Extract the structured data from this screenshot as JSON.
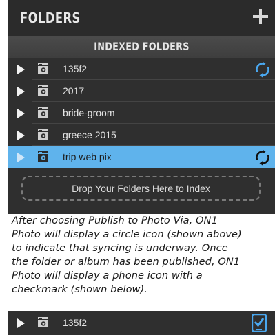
{
  "panel": {
    "title": "FOLDERS",
    "add_icon": "plus-icon",
    "section_title": "INDEXED FOLDERS",
    "folders": [
      {
        "name": "135f2",
        "syncing": true,
        "selected": false
      },
      {
        "name": "2017",
        "syncing": false,
        "selected": false
      },
      {
        "name": "bride-groom",
        "syncing": false,
        "selected": false
      },
      {
        "name": "greece 2015",
        "syncing": false,
        "selected": false
      },
      {
        "name": "trip web pix",
        "syncing": true,
        "selected": true
      }
    ],
    "drop_zone": "Drop Your Folders Here to Index"
  },
  "caption": {
    "lines": [
      "After choosing Publish to Photo Via, ON1",
      "Photo will display a circle icon (shown above)",
      "to indicate that syncing is underway. Once",
      "the folder or album has been published, ON1",
      "Photo will display a phone icon with a",
      "checkmark (shown below)."
    ]
  },
  "published_row": {
    "name": "135f2",
    "status_icon": "phone-checkmark-icon"
  },
  "colors": {
    "panel_bg": "#2f2f2f",
    "selected_bg": "#5fb3ec",
    "sync_icon": "#4aa8f0",
    "sync_icon_on_selected": "#111111",
    "text_light": "#e4e4e4"
  }
}
